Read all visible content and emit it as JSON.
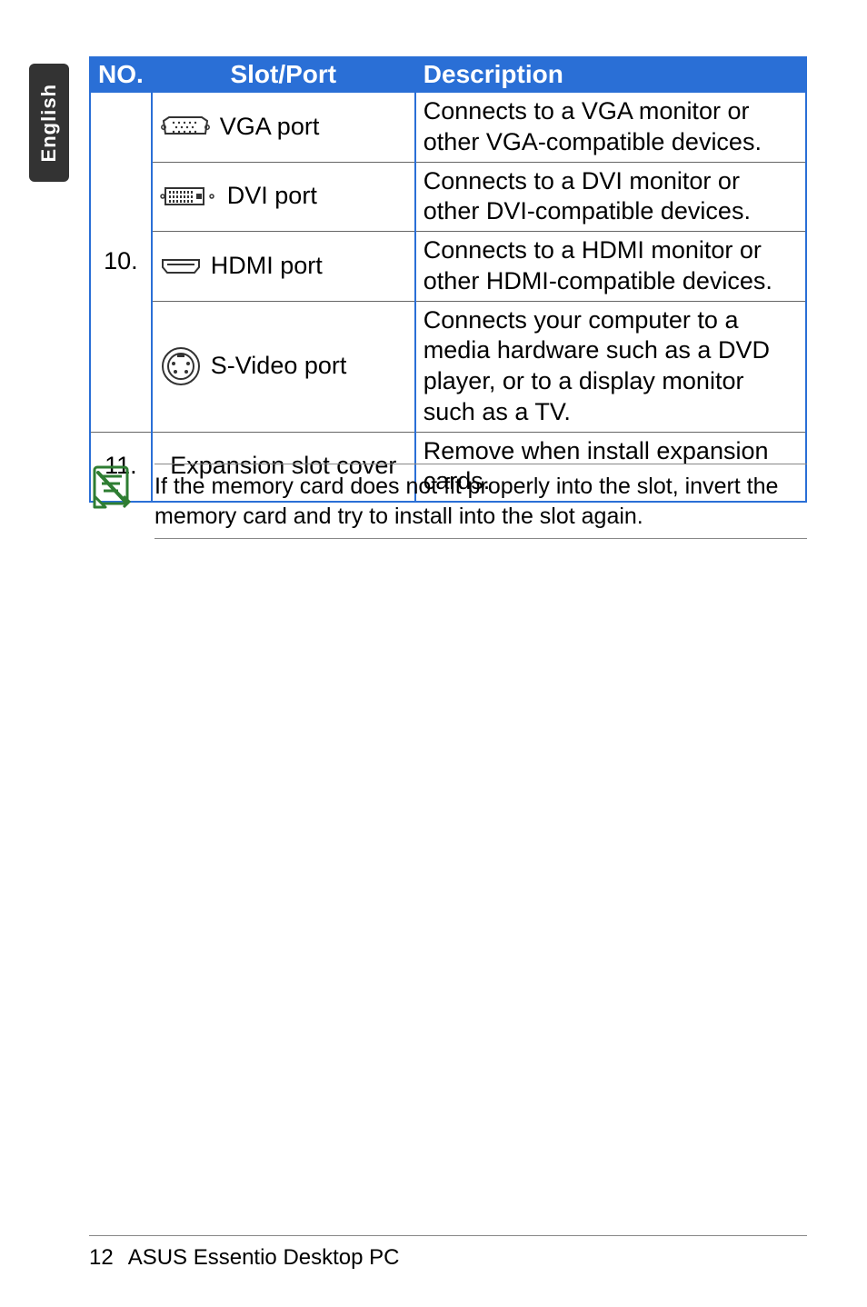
{
  "side_tab": "English",
  "table": {
    "headers": {
      "no": "NO.",
      "slot": "Slot/Port",
      "desc": "Description"
    },
    "group10": {
      "no": "10.",
      "rows": [
        {
          "slot_label": "VGA port",
          "desc": "Connects to a VGA monitor or other VGA-compatible devices."
        },
        {
          "slot_label": "DVI port",
          "desc": "Connects to a DVI monitor or other DVI-compatible devices."
        },
        {
          "slot_label": "HDMI port",
          "desc": "Connects to a HDMI monitor or other HDMI-compatible devices."
        },
        {
          "slot_label": "S-Video port",
          "desc": "Connects your computer to a media hardware such as a DVD player, or to a display monitor such as a TV."
        }
      ]
    },
    "row11": {
      "no": "11.",
      "slot_label": "Expansion slot cover",
      "desc": "Remove when install expansion cards."
    }
  },
  "note": "If the memory card does not fit properly into the slot, invert the memory card and try to install into the slot again.",
  "footer": {
    "page": "12",
    "title": "ASUS Essentio Desktop PC"
  }
}
